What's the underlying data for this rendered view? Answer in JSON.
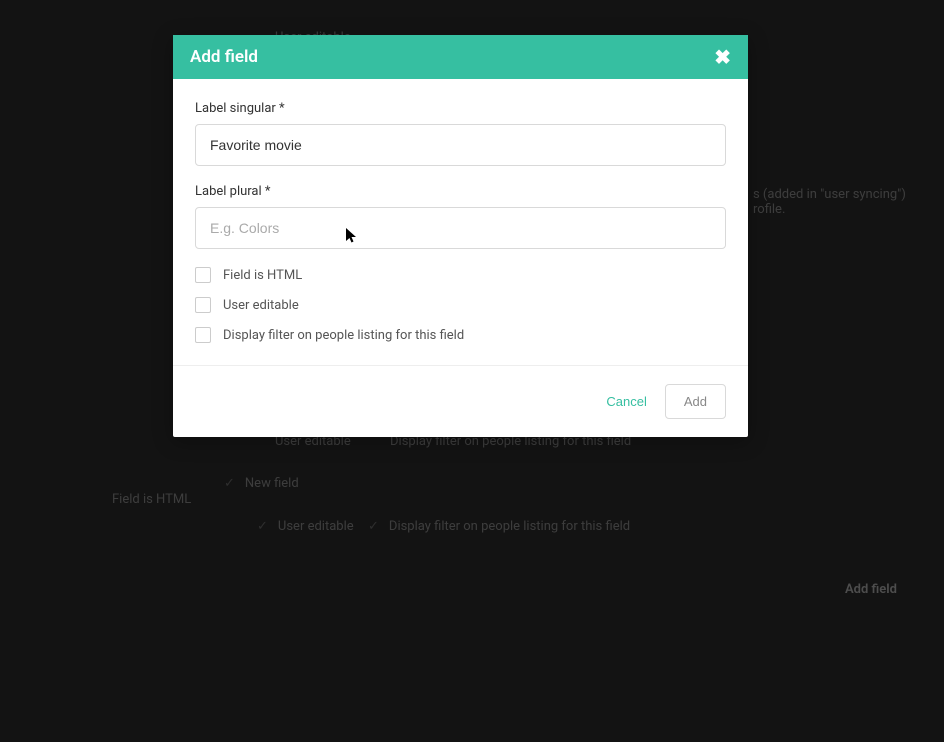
{
  "modal": {
    "title": "Add field",
    "labelSingular": {
      "label": "Label singular *",
      "value": "Favorite movie"
    },
    "labelPlural": {
      "label": "Label plural *",
      "placeholder": "E.g. Colors",
      "value": ""
    },
    "checkboxes": {
      "fieldIsHtml": "Field is HTML",
      "userEditable": "User editable",
      "displayFilter": "Display filter on people listing for this field"
    },
    "footer": {
      "cancel": "Cancel",
      "add": "Add"
    }
  },
  "background": {
    "userEditable1": "User editable",
    "addedInSyncing": "s (added in \"user syncing\")",
    "rofile": "rofile.",
    "userEditable2": "User editable",
    "displayFilter1": "Display filter on people listing for this field",
    "newField": "New field",
    "fieldIsHtml": "Field is HTML",
    "userEditable3": "User editable",
    "displayFilter2": "Display filter on people listing for this field",
    "addField": "Add field"
  }
}
